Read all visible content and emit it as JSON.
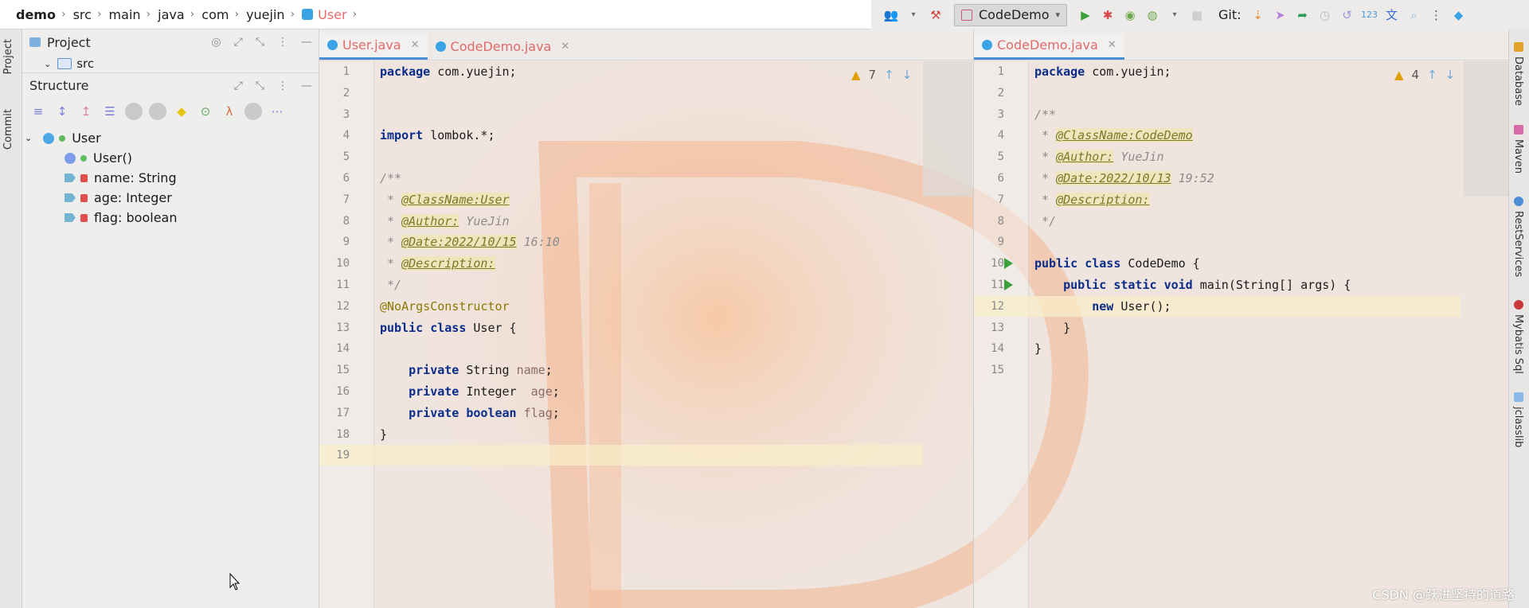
{
  "breadcrumb": [
    {
      "label": "demo"
    },
    {
      "label": "src"
    },
    {
      "label": "main"
    },
    {
      "label": "java"
    },
    {
      "label": "com"
    },
    {
      "label": "yuejin"
    },
    {
      "label": "User"
    }
  ],
  "toolbar": {
    "run_config": "CodeDemo",
    "git_label": "Git:"
  },
  "left_tabs": {
    "project": "Project",
    "commit": "Commit"
  },
  "project_panel": {
    "title": "Project",
    "item": "src"
  },
  "structure_panel": {
    "title": "Structure",
    "tree": {
      "root": "User",
      "children": [
        "User()",
        "name: String",
        "age: Integer",
        "flag: boolean"
      ]
    }
  },
  "editor_left": {
    "tabs": [
      "User.java",
      "CodeDemo.java"
    ],
    "warning_count": "7",
    "lines": [
      {
        "n": "1",
        "t": "package com.yuejin;"
      },
      {
        "n": "2",
        "t": ""
      },
      {
        "n": "3",
        "t": ""
      },
      {
        "n": "4",
        "t": "import lombok.*;"
      },
      {
        "n": "5",
        "t": ""
      },
      {
        "n": "6",
        "t": "/**"
      },
      {
        "n": "7",
        "t": " * @ClassName:User"
      },
      {
        "n": "8",
        "t": " * @Author: YueJin"
      },
      {
        "n": "9",
        "t": " * @Date:2022/10/15 16:10"
      },
      {
        "n": "10",
        "t": " * @Description: "
      },
      {
        "n": "11",
        "t": " */"
      },
      {
        "n": "12",
        "t": "@NoArgsConstructor"
      },
      {
        "n": "13",
        "t": "public class User {"
      },
      {
        "n": "14",
        "t": ""
      },
      {
        "n": "15",
        "t": "    private String name;"
      },
      {
        "n": "16",
        "t": "    private Integer  age;"
      },
      {
        "n": "17",
        "t": "    private boolean flag;"
      },
      {
        "n": "18",
        "t": "}"
      },
      {
        "n": "19",
        "t": ""
      }
    ]
  },
  "editor_right": {
    "tabs": [
      "CodeDemo.java"
    ],
    "warning_count": "4",
    "lines": [
      {
        "n": "1",
        "t": "package com.yuejin;"
      },
      {
        "n": "2",
        "t": ""
      },
      {
        "n": "3",
        "t": "/**"
      },
      {
        "n": "4",
        "t": " * @ClassName:CodeDemo"
      },
      {
        "n": "5",
        "t": " * @Author: YueJin"
      },
      {
        "n": "6",
        "t": " * @Date:2022/10/13 19:52"
      },
      {
        "n": "7",
        "t": " * @Description: "
      },
      {
        "n": "8",
        "t": " */"
      },
      {
        "n": "9",
        "t": ""
      },
      {
        "n": "10",
        "t": "public class CodeDemo {"
      },
      {
        "n": "11",
        "t": "    public static void main(String[] args) {"
      },
      {
        "n": "12",
        "t": "        new User();"
      },
      {
        "n": "13",
        "t": "    }"
      },
      {
        "n": "14",
        "t": "}"
      },
      {
        "n": "15",
        "t": ""
      }
    ]
  },
  "right_tabs": [
    "Database",
    "Maven",
    "RestServices",
    "Mybatis Sql",
    "jclasslib"
  ],
  "watermark": "CSDN @跃进坚持的道路",
  "colors": {
    "accent": "#4a8ed8",
    "tab_text": "#e06a6a",
    "keyword": "#0a2c8a",
    "warning": "#e0a000"
  }
}
